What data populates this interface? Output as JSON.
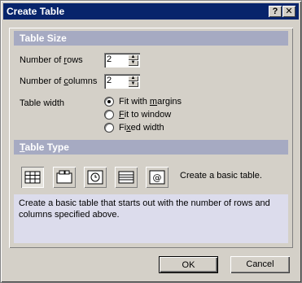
{
  "title": "Create Table",
  "title_buttons": {
    "help": "?",
    "close": "✕"
  },
  "table_size": {
    "heading": "Table Size",
    "rows_label_pre": "Number of ",
    "rows_label_u": "r",
    "rows_label_post": "ows",
    "rows_value": "2",
    "cols_label_pre": "Number of ",
    "cols_label_u": "c",
    "cols_label_post": "olumns",
    "cols_value": "2",
    "width_label": "Table width",
    "width_options": [
      {
        "pre": "Fit with ",
        "u": "m",
        "post": "argins",
        "selected": true
      },
      {
        "pre": "",
        "u": "F",
        "post": "it to window",
        "selected": false
      },
      {
        "pre": "Fi",
        "u": "x",
        "post": "ed width",
        "selected": false
      }
    ]
  },
  "table_type": {
    "heading_u": "T",
    "heading_post": "able Type",
    "types": [
      {
        "icon": "basic-table-icon",
        "selected": true
      },
      {
        "icon": "header-table-icon",
        "selected": false
      },
      {
        "icon": "calendar-table-icon",
        "selected": false
      },
      {
        "icon": "stripe-table-icon",
        "selected": false
      },
      {
        "icon": "email-table-icon",
        "selected": false
      }
    ],
    "selected_label": "Create a basic table.",
    "description": "Create a basic table that starts out with the number of rows and columns specified above."
  },
  "buttons": {
    "ok": "OK",
    "cancel": "Cancel"
  }
}
